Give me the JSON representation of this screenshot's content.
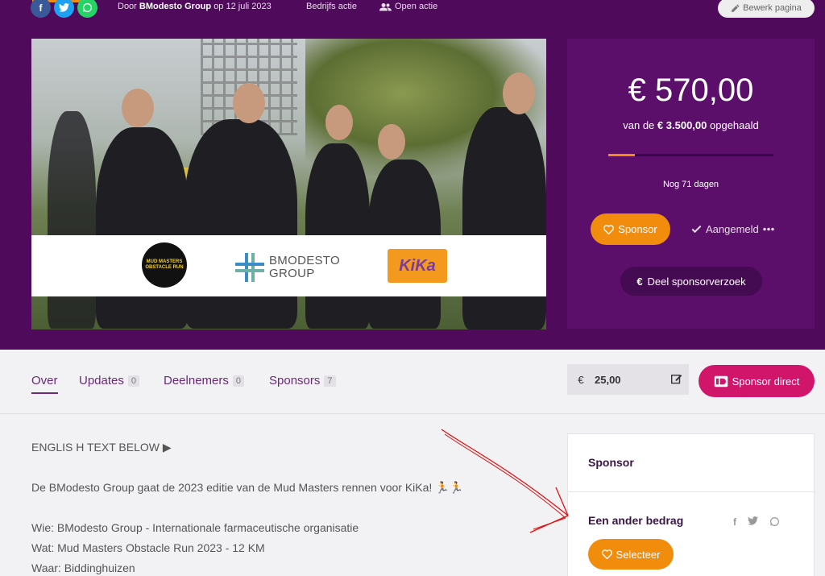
{
  "colors": {
    "hero_bg": "#4f0a5b",
    "panel_bg": "#5c0e6b",
    "accent_orange": "#f28c0c",
    "accent_pink": "#d1156b"
  },
  "header": {
    "social_icons": [
      "facebook-icon",
      "twitter-icon",
      "whatsapp-icon"
    ],
    "author_prefix": "Door",
    "author": "BModesto Group",
    "date": "op 12 juli 2023",
    "category": "Bedrijfs actie",
    "visibility": "Open actie",
    "edit_label": "Bewerk pagina"
  },
  "hero_image": {
    "logos": {
      "mud_masters": "MUD MASTERS OBSTACLE RUN",
      "bmodesto_line1": "BMODESTO",
      "bmodesto_line2": "GROUP",
      "kika": "KiKa"
    }
  },
  "campaign": {
    "raised": "€ 570,00",
    "goal_prefix": "van de",
    "goal": "€ 3.500,00",
    "goal_suffix": "opgehaald",
    "progress_fraction": 0.163,
    "days_left": "Nog 71 dagen",
    "sponsor_label": "Sponsor",
    "joined_label": "Aangemeld",
    "share_label": "Deel sponsorverzoek"
  },
  "tabs": [
    {
      "label": "Over",
      "count": ""
    },
    {
      "label": "Updates",
      "count": "0"
    },
    {
      "label": "Deelnemers",
      "count": "0"
    },
    {
      "label": "Sponsors",
      "count": "7"
    }
  ],
  "quick_sponsor": {
    "currency": "€",
    "amount": "25,00",
    "button_label": "Sponsor direct"
  },
  "content": {
    "lines": [
      "ENGLIS H TEXT BELOW ▶",
      "",
      "De BModesto Group gaat de 2023 editie van de Mud Masters rennen voor KiKa! 🏃🏃",
      "",
      "Wie: BModesto Group - Internationale farmaceutische organisatie",
      "Wat: Mud Masters Obstacle Run 2023 - 12 KM",
      "Waar: Biddinghuizen"
    ]
  },
  "sidebar": {
    "title": "Sponsor",
    "other_amount_title": "Een ander bedrag",
    "select_label": "Selecteer"
  }
}
